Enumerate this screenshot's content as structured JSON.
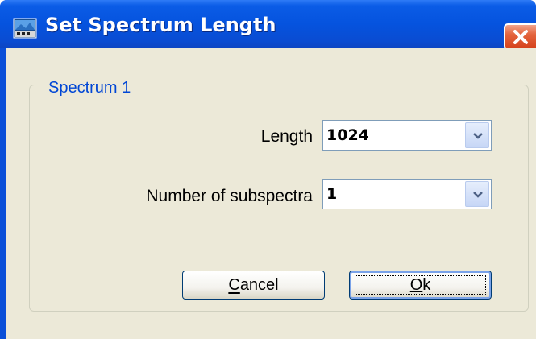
{
  "window": {
    "title": "Set Spectrum Length",
    "icon": "app-icon",
    "close_icon": "close-icon"
  },
  "group": {
    "legend": "Spectrum 1"
  },
  "fields": {
    "length": {
      "label": "Length",
      "value": "1024",
      "icon": "chevron-down-icon"
    },
    "subspectra": {
      "label": "Number of subspectra",
      "value": "1",
      "icon": "chevron-down-icon"
    }
  },
  "buttons": {
    "cancel": {
      "label": "Cancel",
      "mnemonic": "C"
    },
    "ok": {
      "label": "Ok",
      "mnemonic": "O"
    }
  },
  "colors": {
    "titlebar": "#0553de",
    "client": "#ece9d8",
    "legend": "#0046d5",
    "close": "#d5421b"
  }
}
